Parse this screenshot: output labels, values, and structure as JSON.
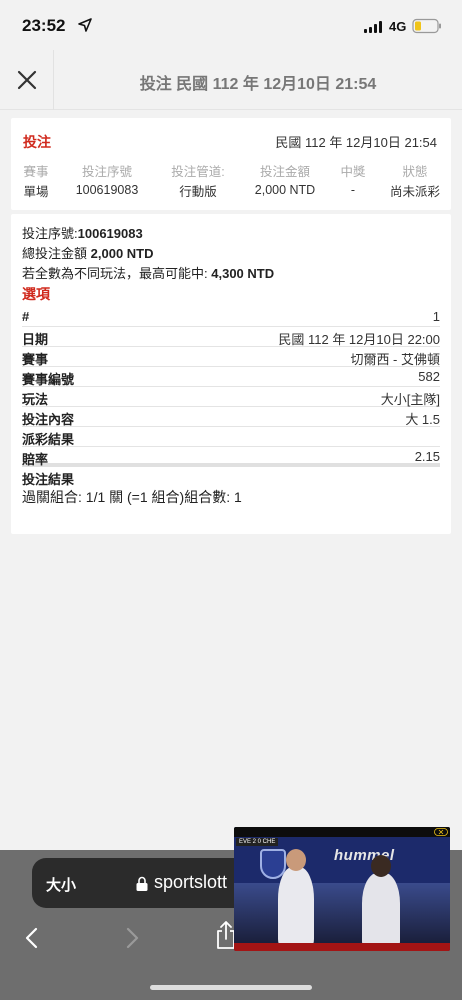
{
  "status_bar": {
    "time": "23:52",
    "network": "4G"
  },
  "header": {
    "title": "投注 民國 112 年 12月10日 21:54"
  },
  "summary": {
    "type": "投注",
    "date": "民國 112 年 12月10日 21:54",
    "headers": [
      "賽事",
      "投注序號",
      "投注管道:",
      "投注金額",
      "中獎",
      "狀態"
    ],
    "values": [
      "單場",
      "100619083",
      "行動版",
      "2,000 NTD",
      "-",
      "尚未派彩"
    ]
  },
  "detail": {
    "serial_label": "投注序號:",
    "serial_value": "100619083",
    "total_label": "總投注金額",
    "total_value": "2,000 NTD",
    "max_label": "若全數為不同玩法，最高可能中:",
    "max_value": "4,300 NTD",
    "section_title": "選項",
    "rows": [
      {
        "key": "#",
        "value": "1"
      },
      {
        "key": "日期",
        "value": "民國 112 年 12月10日 22:00"
      },
      {
        "key": "賽事",
        "value": "切爾西 - 艾佛頓"
      },
      {
        "key": "賽事編號",
        "value": "582"
      },
      {
        "key": "玩法",
        "value": "大小[主隊]"
      },
      {
        "key": "投注內容",
        "value": "大 1.5"
      },
      {
        "key": "派彩結果",
        "value": ""
      },
      {
        "key": "賠率",
        "value": "2.15"
      },
      {
        "key": "投注結果",
        "value": ""
      }
    ],
    "combo": "過關組合: 1/1 關 (=1 組合)組合數: 1"
  },
  "browser": {
    "text_size_label": "大小",
    "url": "sportslott"
  },
  "video": {
    "brand": "hummel",
    "score_label": "EVE 2 0 CHE"
  },
  "colors": {
    "accent": "#d02a1e",
    "background": "#f2f2f2",
    "card": "#ffffff"
  }
}
